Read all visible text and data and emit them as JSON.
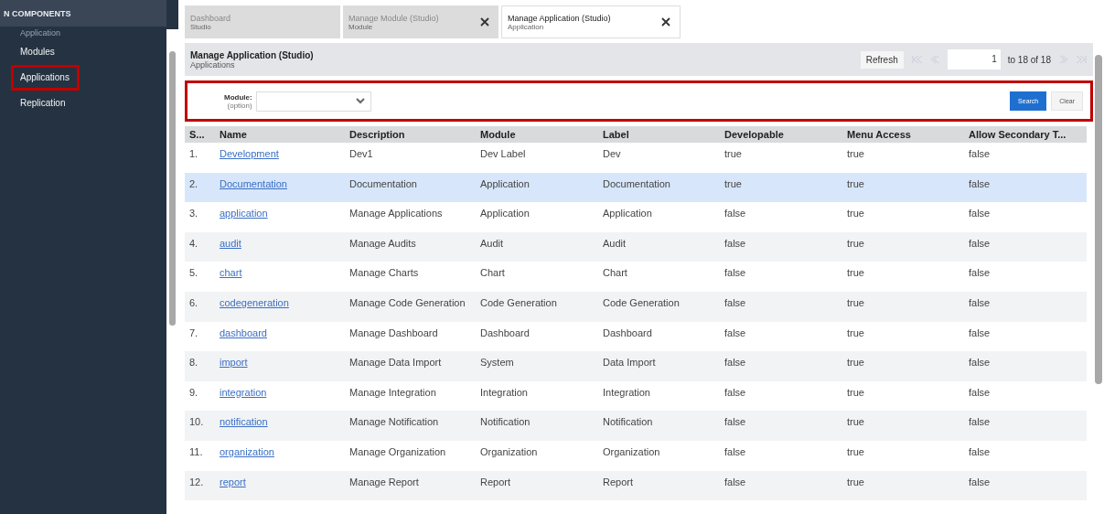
{
  "sidebar": {
    "header": "N COMPONENTS",
    "items": [
      {
        "label": "Application",
        "selected": false,
        "dim": true
      },
      {
        "label": "Modules",
        "selected": false,
        "dim": false
      },
      {
        "label": "Applications",
        "selected": true,
        "dim": false
      },
      {
        "label": "Replication",
        "selected": false,
        "dim": false
      }
    ]
  },
  "tabs": [
    {
      "title": "Dashboard",
      "subtitle": "Studio",
      "selected": false,
      "closable": false
    },
    {
      "title": "Manage Module (Studio)",
      "subtitle": "Module",
      "selected": false,
      "closable": true
    },
    {
      "title": "Manage Application (Studio)",
      "subtitle": "Application",
      "selected": true,
      "closable": true
    }
  ],
  "page": {
    "title": "Manage Application (Studio)",
    "subtitle": "Applications"
  },
  "pager": {
    "refresh": "Refresh",
    "page": "1",
    "range": "to 18 of 18"
  },
  "filter": {
    "label": "Module:",
    "hint": "(option)",
    "search": "Search",
    "clear": "Clear"
  },
  "table": {
    "columns": [
      "S...",
      "Name",
      "Description",
      "Module",
      "Label",
      "Developable",
      "Menu Access",
      "Allow Secondary T..."
    ],
    "rows": [
      {
        "selected": false,
        "cells": [
          "1.",
          "Development",
          "Dev1",
          "Dev Label",
          "Dev",
          "true",
          "true",
          "false"
        ]
      },
      {
        "selected": true,
        "cells": [
          "2.",
          "Documentation",
          "Documentation",
          "Application",
          "Documentation",
          "true",
          "true",
          "false"
        ]
      },
      {
        "selected": false,
        "cells": [
          "3.",
          "application",
          "Manage Applications",
          "Application",
          "Application",
          "false",
          "true",
          "false"
        ]
      },
      {
        "selected": false,
        "cells": [
          "4.",
          "audit",
          "Manage Audits",
          "Audit",
          "Audit",
          "false",
          "true",
          "false"
        ]
      },
      {
        "selected": false,
        "cells": [
          "5.",
          "chart",
          "Manage Charts",
          "Chart",
          "Chart",
          "false",
          "true",
          "false"
        ]
      },
      {
        "selected": false,
        "cells": [
          "6.",
          "codegeneration",
          "Manage Code Generation",
          "Code Generation",
          "Code Generation",
          "false",
          "true",
          "false"
        ]
      },
      {
        "selected": false,
        "cells": [
          "7.",
          "dashboard",
          "Manage Dashboard",
          "Dashboard",
          "Dashboard",
          "false",
          "true",
          "false"
        ]
      },
      {
        "selected": false,
        "cells": [
          "8.",
          "import",
          "Manage Data Import",
          "System",
          "Data Import",
          "false",
          "true",
          "false"
        ]
      },
      {
        "selected": false,
        "cells": [
          "9.",
          "integration",
          "Manage Integration",
          "Integration",
          "Integration",
          "false",
          "true",
          "false"
        ]
      },
      {
        "selected": false,
        "cells": [
          "10.",
          "notification",
          "Manage Notification",
          "Notification",
          "Notification",
          "false",
          "true",
          "false"
        ]
      },
      {
        "selected": false,
        "cells": [
          "11.",
          "organization",
          "Manage Organization",
          "Organization",
          "Organization",
          "false",
          "true",
          "false"
        ]
      },
      {
        "selected": false,
        "cells": [
          "12.",
          "report",
          "Manage Report",
          "Report",
          "Report",
          "false",
          "true",
          "false"
        ]
      }
    ]
  }
}
